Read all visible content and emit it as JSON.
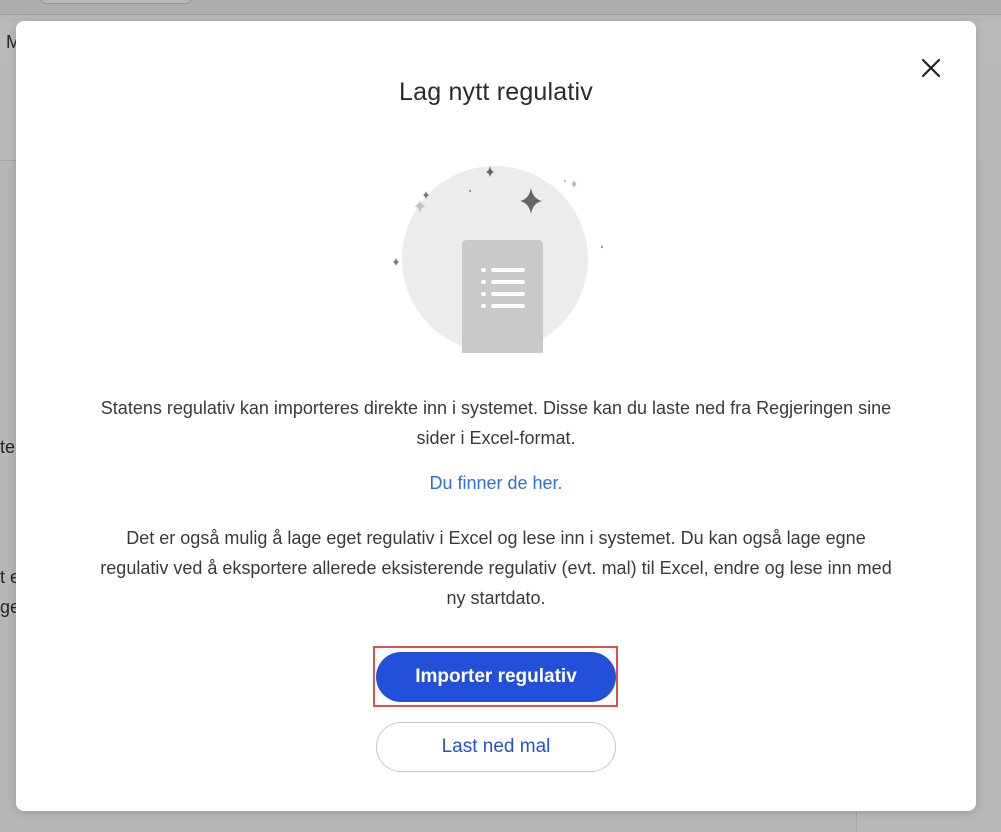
{
  "background": {
    "fragments": [
      "M",
      "te",
      "t e",
      "ge"
    ]
  },
  "modal": {
    "title": "Lag nytt regulativ",
    "close_icon": "close-icon",
    "illustration_icon": "document-sparkle-illustration",
    "paragraph1": "Statens regulativ kan importeres direkte inn i systemet. Disse kan du laste ned fra Regjeringen sine sider i Excel-format.",
    "link_text": "Du finner de her.",
    "paragraph2": "Det er også mulig å lage eget regulativ i Excel og lese inn i systemet. Du kan også lage egne regulativ ved å eksportere allerede eksisterende regulativ (evt. mal) til Excel, endre og lese inn med ny startdato.",
    "primary_button": "Importer regulativ",
    "secondary_button": "Last ned mal"
  },
  "colors": {
    "primary": "#2350d9",
    "link": "#2d6fdc",
    "highlight": "#d9534f"
  }
}
